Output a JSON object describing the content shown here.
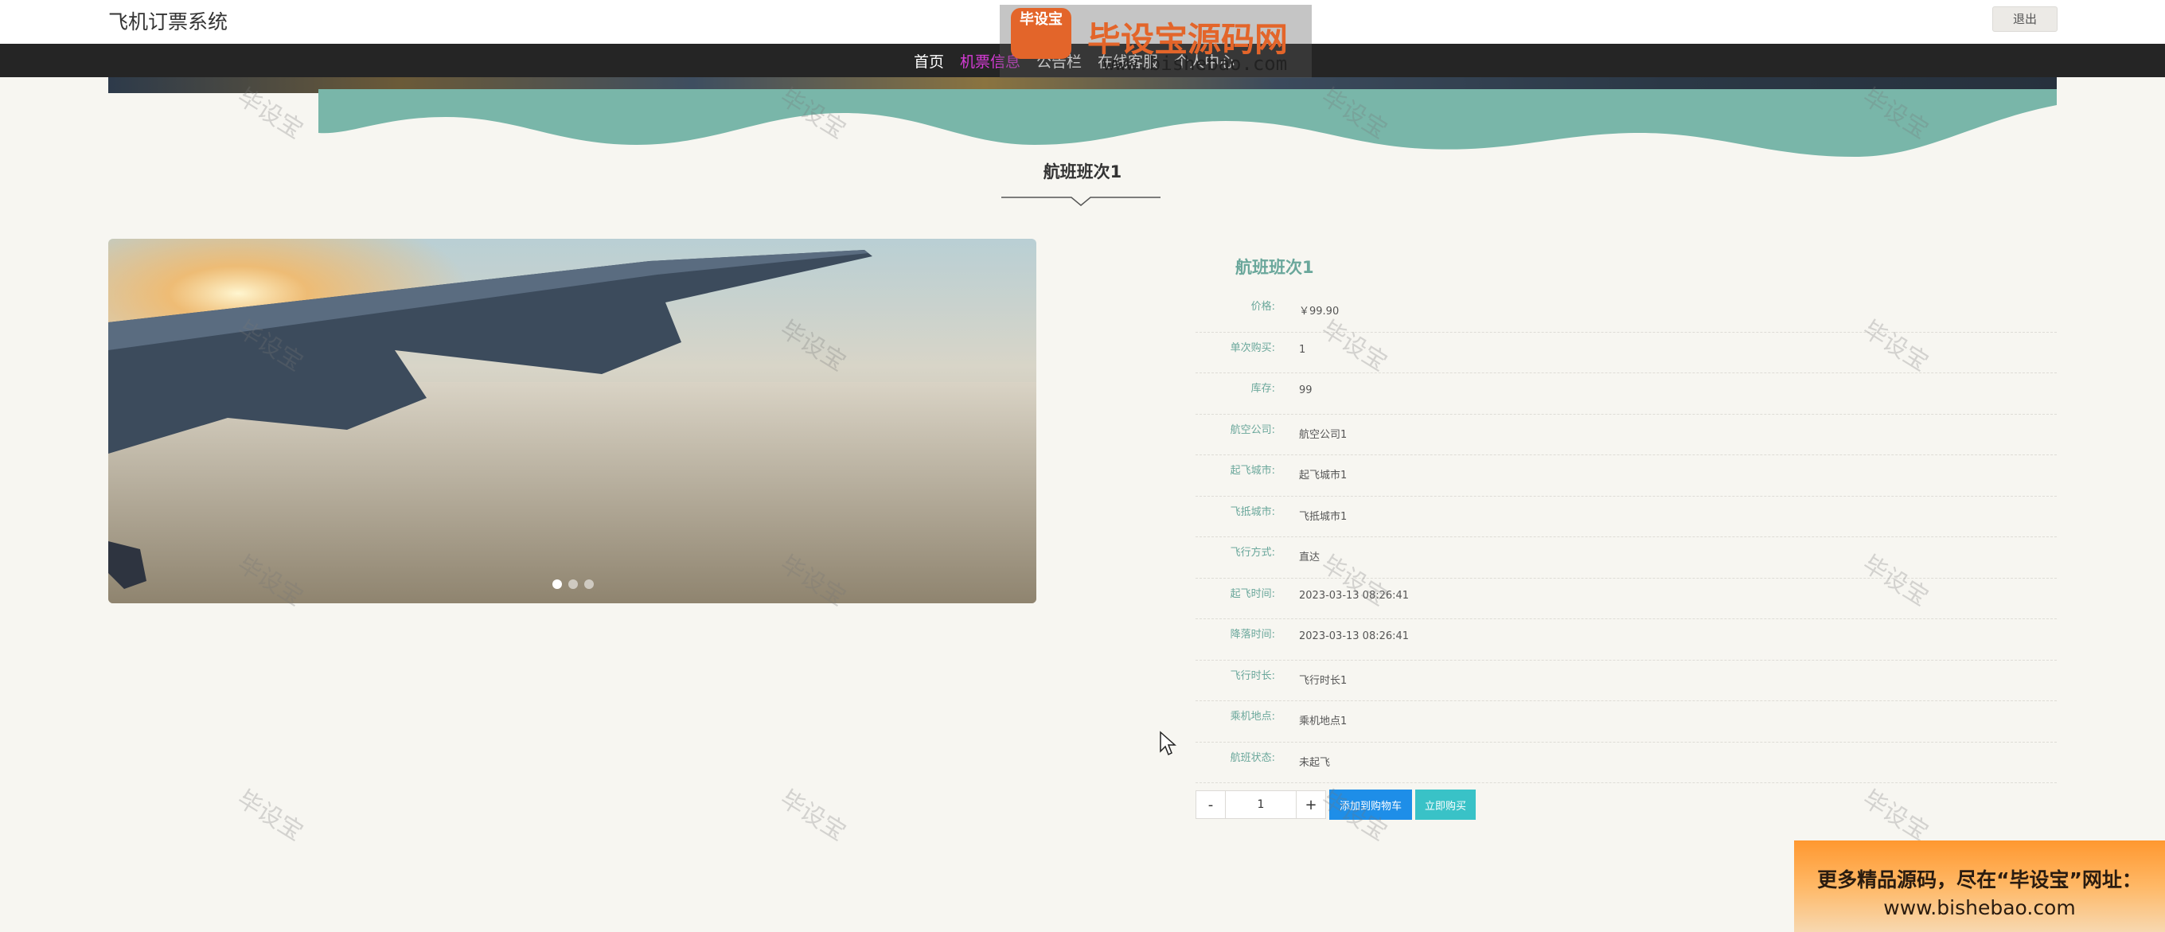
{
  "header": {
    "site_title": "飞机订票系统",
    "logout_label": "退出"
  },
  "nav": {
    "items": [
      {
        "label": "首页",
        "active": false
      },
      {
        "label": "机票信息",
        "active": true
      },
      {
        "label": "公告栏",
        "active": false
      },
      {
        "label": "在线客服",
        "active": false
      },
      {
        "label": "个人中心",
        "active": false
      }
    ]
  },
  "page": {
    "section_title": "航班班次1"
  },
  "carousel": {
    "slide_count": 3,
    "active_index": 0
  },
  "detail": {
    "name": "航班班次1",
    "fields": [
      {
        "label": "价格:",
        "value": "￥99.90"
      },
      {
        "label": "单次购买:",
        "value": "1"
      },
      {
        "label": "库存:",
        "value": "99"
      },
      {
        "label": "航空公司:",
        "value": "航空公司1"
      },
      {
        "label": "起飞城市:",
        "value": "起飞城市1"
      },
      {
        "label": "飞抵城市:",
        "value": "飞抵城市1"
      },
      {
        "label": "飞行方式:",
        "value": "直达"
      },
      {
        "label": "起飞时间:",
        "value": "2023-03-13 08:26:41"
      },
      {
        "label": "降落时间:",
        "value": "2023-03-13 08:26:41"
      },
      {
        "label": "飞行时长:",
        "value": "飞行时长1"
      },
      {
        "label": "乘机地点:",
        "value": "乘机地点1"
      },
      {
        "label": "航班状态:",
        "value": "未起飞"
      }
    ]
  },
  "purchase": {
    "minus_label": "-",
    "plus_label": "+",
    "quantity": "1",
    "add_to_cart_label": "添加到购物车",
    "buy_now_label": "立即购买"
  },
  "watermark": {
    "text": "毕设宝",
    "logo_badge": "毕设宝",
    "logo_title": "毕设宝源码网",
    "logo_url": "www.bishebao.com"
  },
  "promo": {
    "line1": "更多精品源码，尽在“毕设宝”网址：",
    "line2": "www.bishebao.com"
  },
  "colors": {
    "accent_green": "#6aa79b",
    "nav_active": "#d63bd6",
    "cart_blue": "#1e8ee8",
    "buy_teal": "#39c2c7",
    "background": "#f7f6f1"
  }
}
